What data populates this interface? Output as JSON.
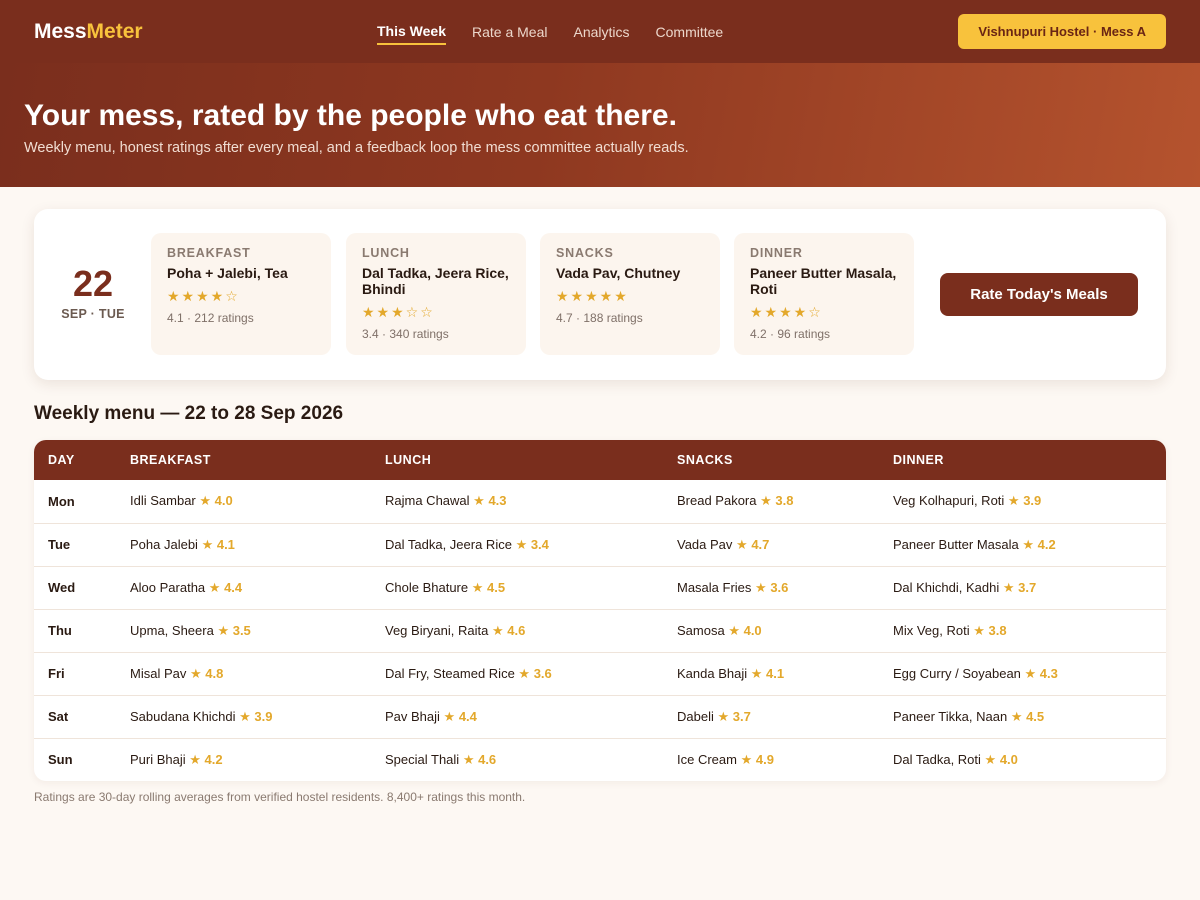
{
  "header": {
    "logo_part1": "Mess",
    "logo_part2": "Meter",
    "nav": [
      {
        "label": "This Week",
        "active": true
      },
      {
        "label": "Rate a Meal",
        "active": false
      },
      {
        "label": "Analytics",
        "active": false
      },
      {
        "label": "Committee",
        "active": false
      }
    ],
    "hostel_label": "Vishnupuri Hostel · Mess A"
  },
  "hero": {
    "title": "Your mess, rated by the people who eat there.",
    "subtitle": "Weekly menu, honest ratings after every meal, and a feedback loop the mess committee actually reads."
  },
  "today": {
    "day": "22",
    "label": "SEP · TUE",
    "meals": [
      {
        "label": "BREAKFAST",
        "name": "Poha + Jalebi, Tea",
        "stars": "★★★★☆",
        "meta": "4.1 · 212 ratings"
      },
      {
        "label": "LUNCH",
        "name": "Dal Tadka, Jeera Rice, Bhindi",
        "stars": "★★★☆☆",
        "meta": "3.4 · 340 ratings"
      },
      {
        "label": "SNACKS",
        "name": "Vada Pav, Chutney",
        "stars": "★★★★★",
        "meta": "4.7 · 188 ratings"
      },
      {
        "label": "DINNER",
        "name": "Paneer Butter Masala, Roti",
        "stars": "★★★★☆",
        "meta": "4.2 · 96 ratings"
      }
    ],
    "rate_button": "Rate Today's Meals"
  },
  "weekly": {
    "title": "Weekly menu — 22 to 28 Sep 2026",
    "columns": [
      "DAY",
      "BREAKFAST",
      "LUNCH",
      "SNACKS",
      "DINNER"
    ],
    "rows": [
      {
        "day": "Mon",
        "cells": [
          {
            "name": "Idli Sambar",
            "rating": "★ 4.0"
          },
          {
            "name": "Rajma Chawal",
            "rating": "★ 4.3"
          },
          {
            "name": "Bread Pakora",
            "rating": "★ 3.8"
          },
          {
            "name": "Veg Kolhapuri, Roti",
            "rating": "★ 3.9"
          }
        ]
      },
      {
        "day": "Tue",
        "cells": [
          {
            "name": "Poha Jalebi",
            "rating": "★ 4.1"
          },
          {
            "name": "Dal Tadka, Jeera Rice",
            "rating": "★ 3.4"
          },
          {
            "name": "Vada Pav",
            "rating": "★ 4.7"
          },
          {
            "name": "Paneer Butter Masala",
            "rating": "★ 4.2"
          }
        ]
      },
      {
        "day": "Wed",
        "cells": [
          {
            "name": "Aloo Paratha",
            "rating": "★ 4.4"
          },
          {
            "name": "Chole Bhature",
            "rating": "★ 4.5"
          },
          {
            "name": "Masala Fries",
            "rating": "★ 3.6"
          },
          {
            "name": "Dal Khichdi, Kadhi",
            "rating": "★ 3.7"
          }
        ]
      },
      {
        "day": "Thu",
        "cells": [
          {
            "name": "Upma, Sheera",
            "rating": "★ 3.5"
          },
          {
            "name": "Veg Biryani, Raita",
            "rating": "★ 4.6"
          },
          {
            "name": "Samosa",
            "rating": "★ 4.0"
          },
          {
            "name": "Mix Veg, Roti",
            "rating": "★ 3.8"
          }
        ]
      },
      {
        "day": "Fri",
        "cells": [
          {
            "name": "Misal Pav",
            "rating": "★ 4.8"
          },
          {
            "name": "Dal Fry, Steamed Rice",
            "rating": "★ 3.6"
          },
          {
            "name": "Kanda Bhaji",
            "rating": "★ 4.1"
          },
          {
            "name": "Egg Curry / Soyabean",
            "rating": "★ 4.3"
          }
        ]
      },
      {
        "day": "Sat",
        "cells": [
          {
            "name": "Sabudana Khichdi",
            "rating": "★ 3.9"
          },
          {
            "name": "Pav Bhaji",
            "rating": "★ 4.4"
          },
          {
            "name": "Dabeli",
            "rating": "★ 3.7"
          },
          {
            "name": "Paneer Tikka, Naan",
            "rating": "★ 4.5"
          }
        ]
      },
      {
        "day": "Sun",
        "cells": [
          {
            "name": "Puri Bhaji",
            "rating": "★ 4.2"
          },
          {
            "name": "Special Thali",
            "rating": "★ 4.6"
          },
          {
            "name": "Ice Cream",
            "rating": "★ 4.9"
          },
          {
            "name": "Dal Tadka, Roti",
            "rating": "★ 4.0"
          }
        ]
      }
    ],
    "footnote": "Ratings are 30-day rolling averages from verified hostel residents. 8,400+ ratings this month."
  }
}
